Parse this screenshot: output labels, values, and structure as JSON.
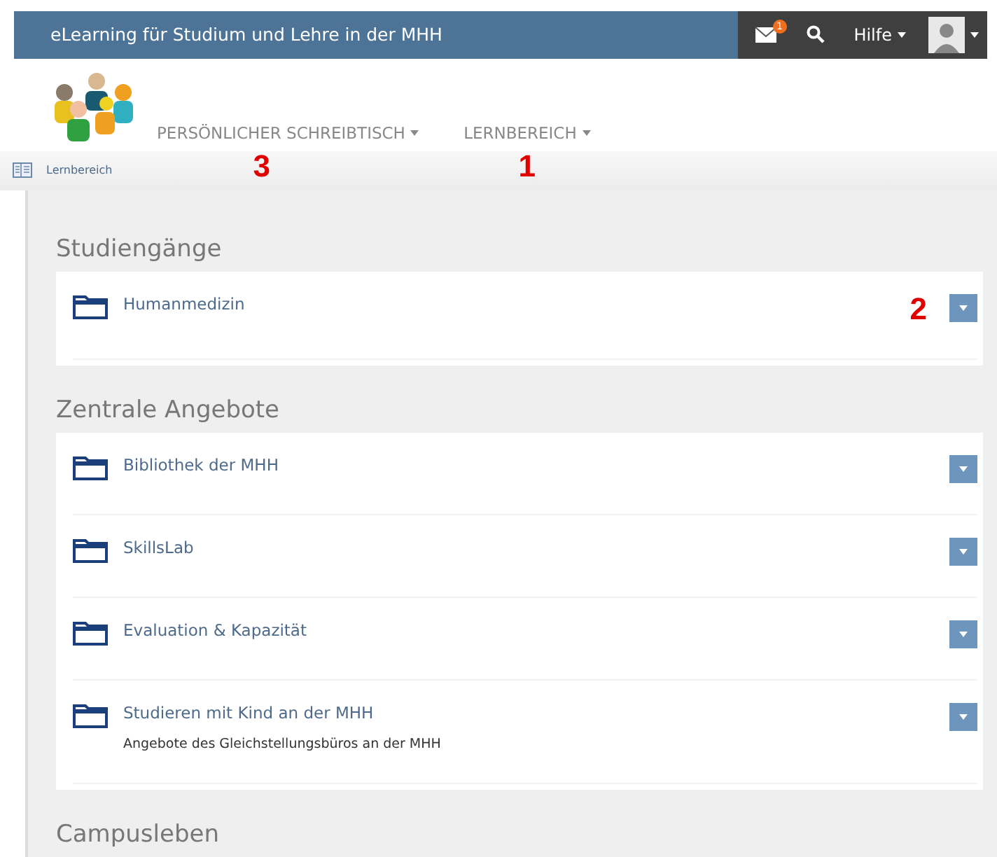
{
  "top_bar": {
    "title": "eLearning für Studium und Lehre in der MHH",
    "mail_badge": "1",
    "help": "Hilfe"
  },
  "main_nav": [
    {
      "label": "PERSÖNLICHER SCHREIBTISCH",
      "callout": "3"
    },
    {
      "label": "LERNBEREICH",
      "callout": "1"
    }
  ],
  "breadcrumb": "Lernbereich",
  "sections": [
    {
      "title": "Studiengänge",
      "items": [
        {
          "title": "Humanmedizin",
          "callout": "2"
        }
      ]
    },
    {
      "title": "Zentrale Angebote",
      "items": [
        {
          "title": "Bibliothek der MHH"
        },
        {
          "title": "SkillsLab"
        },
        {
          "title": "Evaluation & Kapazität"
        },
        {
          "title": "Studieren mit Kind an der MHH",
          "description": "Angebote des Gleichstellungsbüros an der MHH"
        }
      ]
    },
    {
      "title": "Campusleben"
    }
  ]
}
